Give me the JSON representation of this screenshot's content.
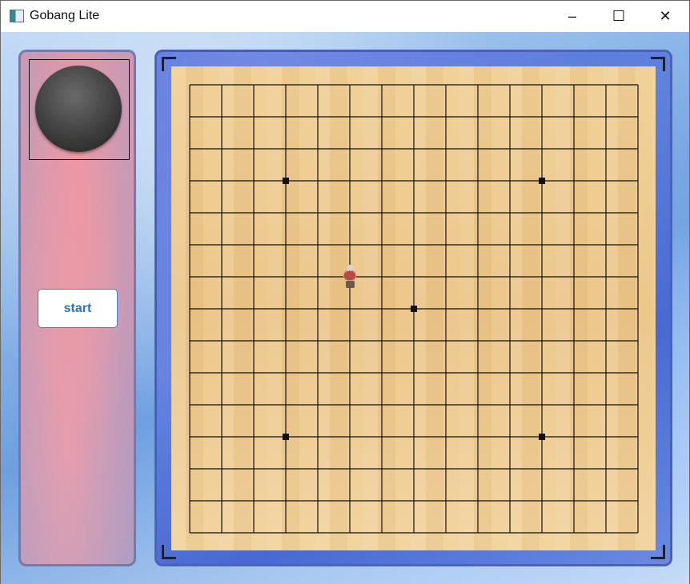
{
  "window": {
    "title": "Gobang Lite",
    "controls": {
      "minimize": "–",
      "maximize": "☐",
      "close": "✕"
    }
  },
  "side_panel": {
    "current_stone_color": "black",
    "start_label": "start"
  },
  "board": {
    "lines": 15,
    "star_points": [
      [
        3,
        3
      ],
      [
        11,
        3
      ],
      [
        7,
        7
      ],
      [
        3,
        11
      ],
      [
        11,
        11
      ]
    ],
    "piece_icon": "character-sprite-icon",
    "piece_position": [
      5,
      6
    ]
  },
  "colors": {
    "accent_text": "#2b73c1",
    "grid_line": "#111111",
    "board_wood": "#ebc487"
  }
}
